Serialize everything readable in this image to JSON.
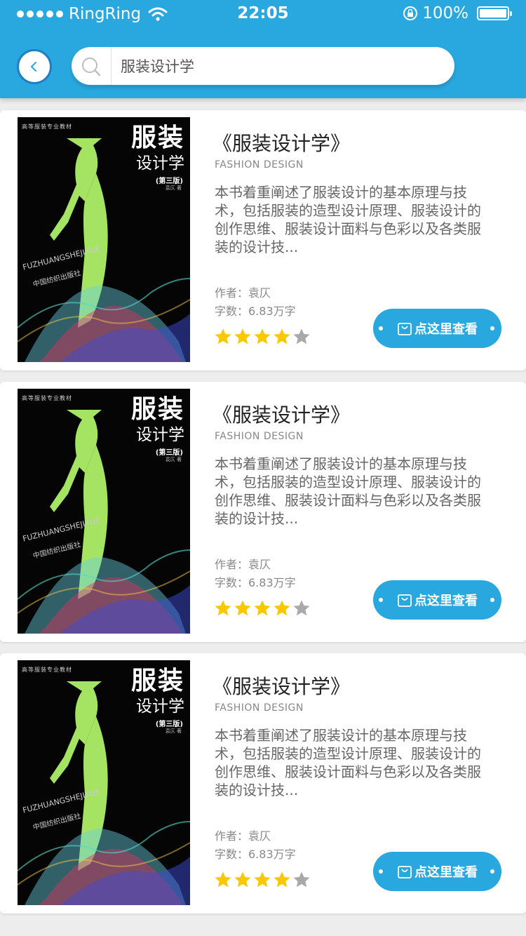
{
  "status_bar": {
    "carrier": "RingRing",
    "time": "22:05",
    "battery": "100%"
  },
  "search": {
    "query": "服装设计学",
    "placeholder": "服装设计学"
  },
  "colors": {
    "brand_blue": "#29a8e0",
    "star_filled": "#f9c800",
    "star_empty": "#a9a9a9"
  },
  "books": [
    {
      "title": "《服装设计学》",
      "subtitle": "FASHION DESIGN",
      "description": "本书着重阐述了服装设计的基本原理与技术，包括服装的造型设计原理、服装设计的创作思维、服装设计面料与色彩以及各类服装的设计技...",
      "author": "作者：袁仄",
      "word_count": "字数：6.83万字",
      "rating": 4,
      "rating_max": 5,
      "button_label": "点这里查看",
      "cover": {
        "series": "高等服装专业教材",
        "title_big": "服装",
        "title_sub": "设计学",
        "edition": "(第三版)",
        "author_line": "袁仄 著",
        "pinyin": "FUZHUANGSHEJIXUE",
        "publisher": "中国纺织出版社"
      }
    },
    {
      "title": "《服装设计学》",
      "subtitle": "FASHION DESIGN",
      "description": "本书着重阐述了服装设计的基本原理与技术，包括服装的造型设计原理、服装设计的创作思维、服装设计面料与色彩以及各类服装的设计技...",
      "author": "作者：袁仄",
      "word_count": "字数：6.83万字",
      "rating": 4,
      "rating_max": 5,
      "button_label": "点这里查看",
      "cover": {
        "series": "高等服装专业教材",
        "title_big": "服装",
        "title_sub": "设计学",
        "edition": "(第三版)",
        "author_line": "袁仄 著",
        "pinyin": "FUZHUANGSHEJIXUE",
        "publisher": "中国纺织出版社"
      }
    },
    {
      "title": "《服装设计学》",
      "subtitle": "FASHION DESIGN",
      "description": "本书着重阐述了服装设计的基本原理与技术，包括服装的造型设计原理、服装设计的创作思维、服装设计面料与色彩以及各类服装的设计技...",
      "author": "作者：袁仄",
      "word_count": "字数：6.83万字",
      "rating": 4,
      "rating_max": 5,
      "button_label": "点这里查看",
      "cover": {
        "series": "高等服装专业教材",
        "title_big": "服装",
        "title_sub": "设计学",
        "edition": "(第三版)",
        "author_line": "袁仄 著",
        "pinyin": "FUZHUANGSHEJIXUE",
        "publisher": "中国纺织出版社"
      }
    }
  ]
}
